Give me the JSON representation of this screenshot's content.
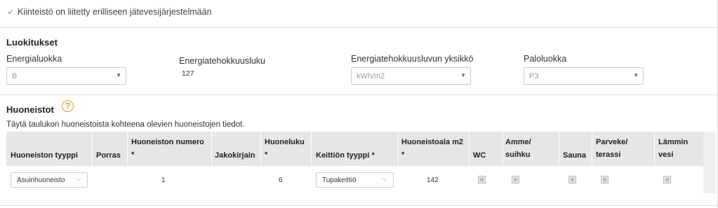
{
  "connected": {
    "label": "Kiinteistö on liitetty erilliseen jätevesijärjestelmään",
    "checked": true
  },
  "classifications": {
    "title": "Luokitukset",
    "energy_class": {
      "label": "Energialuokka",
      "value": "B"
    },
    "energy_efficiency": {
      "label": "Energiatehokkuusluku",
      "value": "127"
    },
    "energy_unit": {
      "label": "Energiatehokkuusluvun yksikkö",
      "value": "kWh/m2"
    },
    "fire_class": {
      "label": "Paloluokka",
      "value": "P3"
    }
  },
  "apartments": {
    "title": "Huoneistot",
    "help_icon": "question-circle-icon",
    "description": "Täytä taulukon huoneistoista kohteena olevien huoneistojen tiedot.",
    "columns": [
      {
        "line1": "Huoneiston tyyppi",
        "line2": ""
      },
      {
        "line1": "Porras",
        "line2": ""
      },
      {
        "line1": "Huoneiston numero",
        "line2": "*"
      },
      {
        "line1": "Jakokirjain",
        "line2": ""
      },
      {
        "line1": "Huoneluku",
        "line2": "*"
      },
      {
        "line1": "Keittiön tyyppi *",
        "line2": ""
      },
      {
        "line1": "Huoneistoala m2",
        "line2": "*"
      },
      {
        "line1": "WC",
        "line2": ""
      },
      {
        "line1": "Amme/",
        "line2": "suihku"
      },
      {
        "line1": "Sauna",
        "line2": ""
      },
      {
        "line1": "Parveke/",
        "line2": "terassi"
      },
      {
        "line1": "Lämmin",
        "line2": "vesi"
      }
    ],
    "rows": [
      {
        "type": "Asuinhuoneisto",
        "stairs": "",
        "number": "1",
        "letter": "",
        "rooms": "6",
        "kitchen": "Tupakeittiö",
        "area": "142",
        "wc": false,
        "bath": false,
        "sauna": false,
        "balcony": false,
        "hot_water": false
      }
    ]
  },
  "colors": {
    "header_bg": "#e6e6e6",
    "help_accent": "#e09a2b",
    "border": "#dddddd"
  }
}
